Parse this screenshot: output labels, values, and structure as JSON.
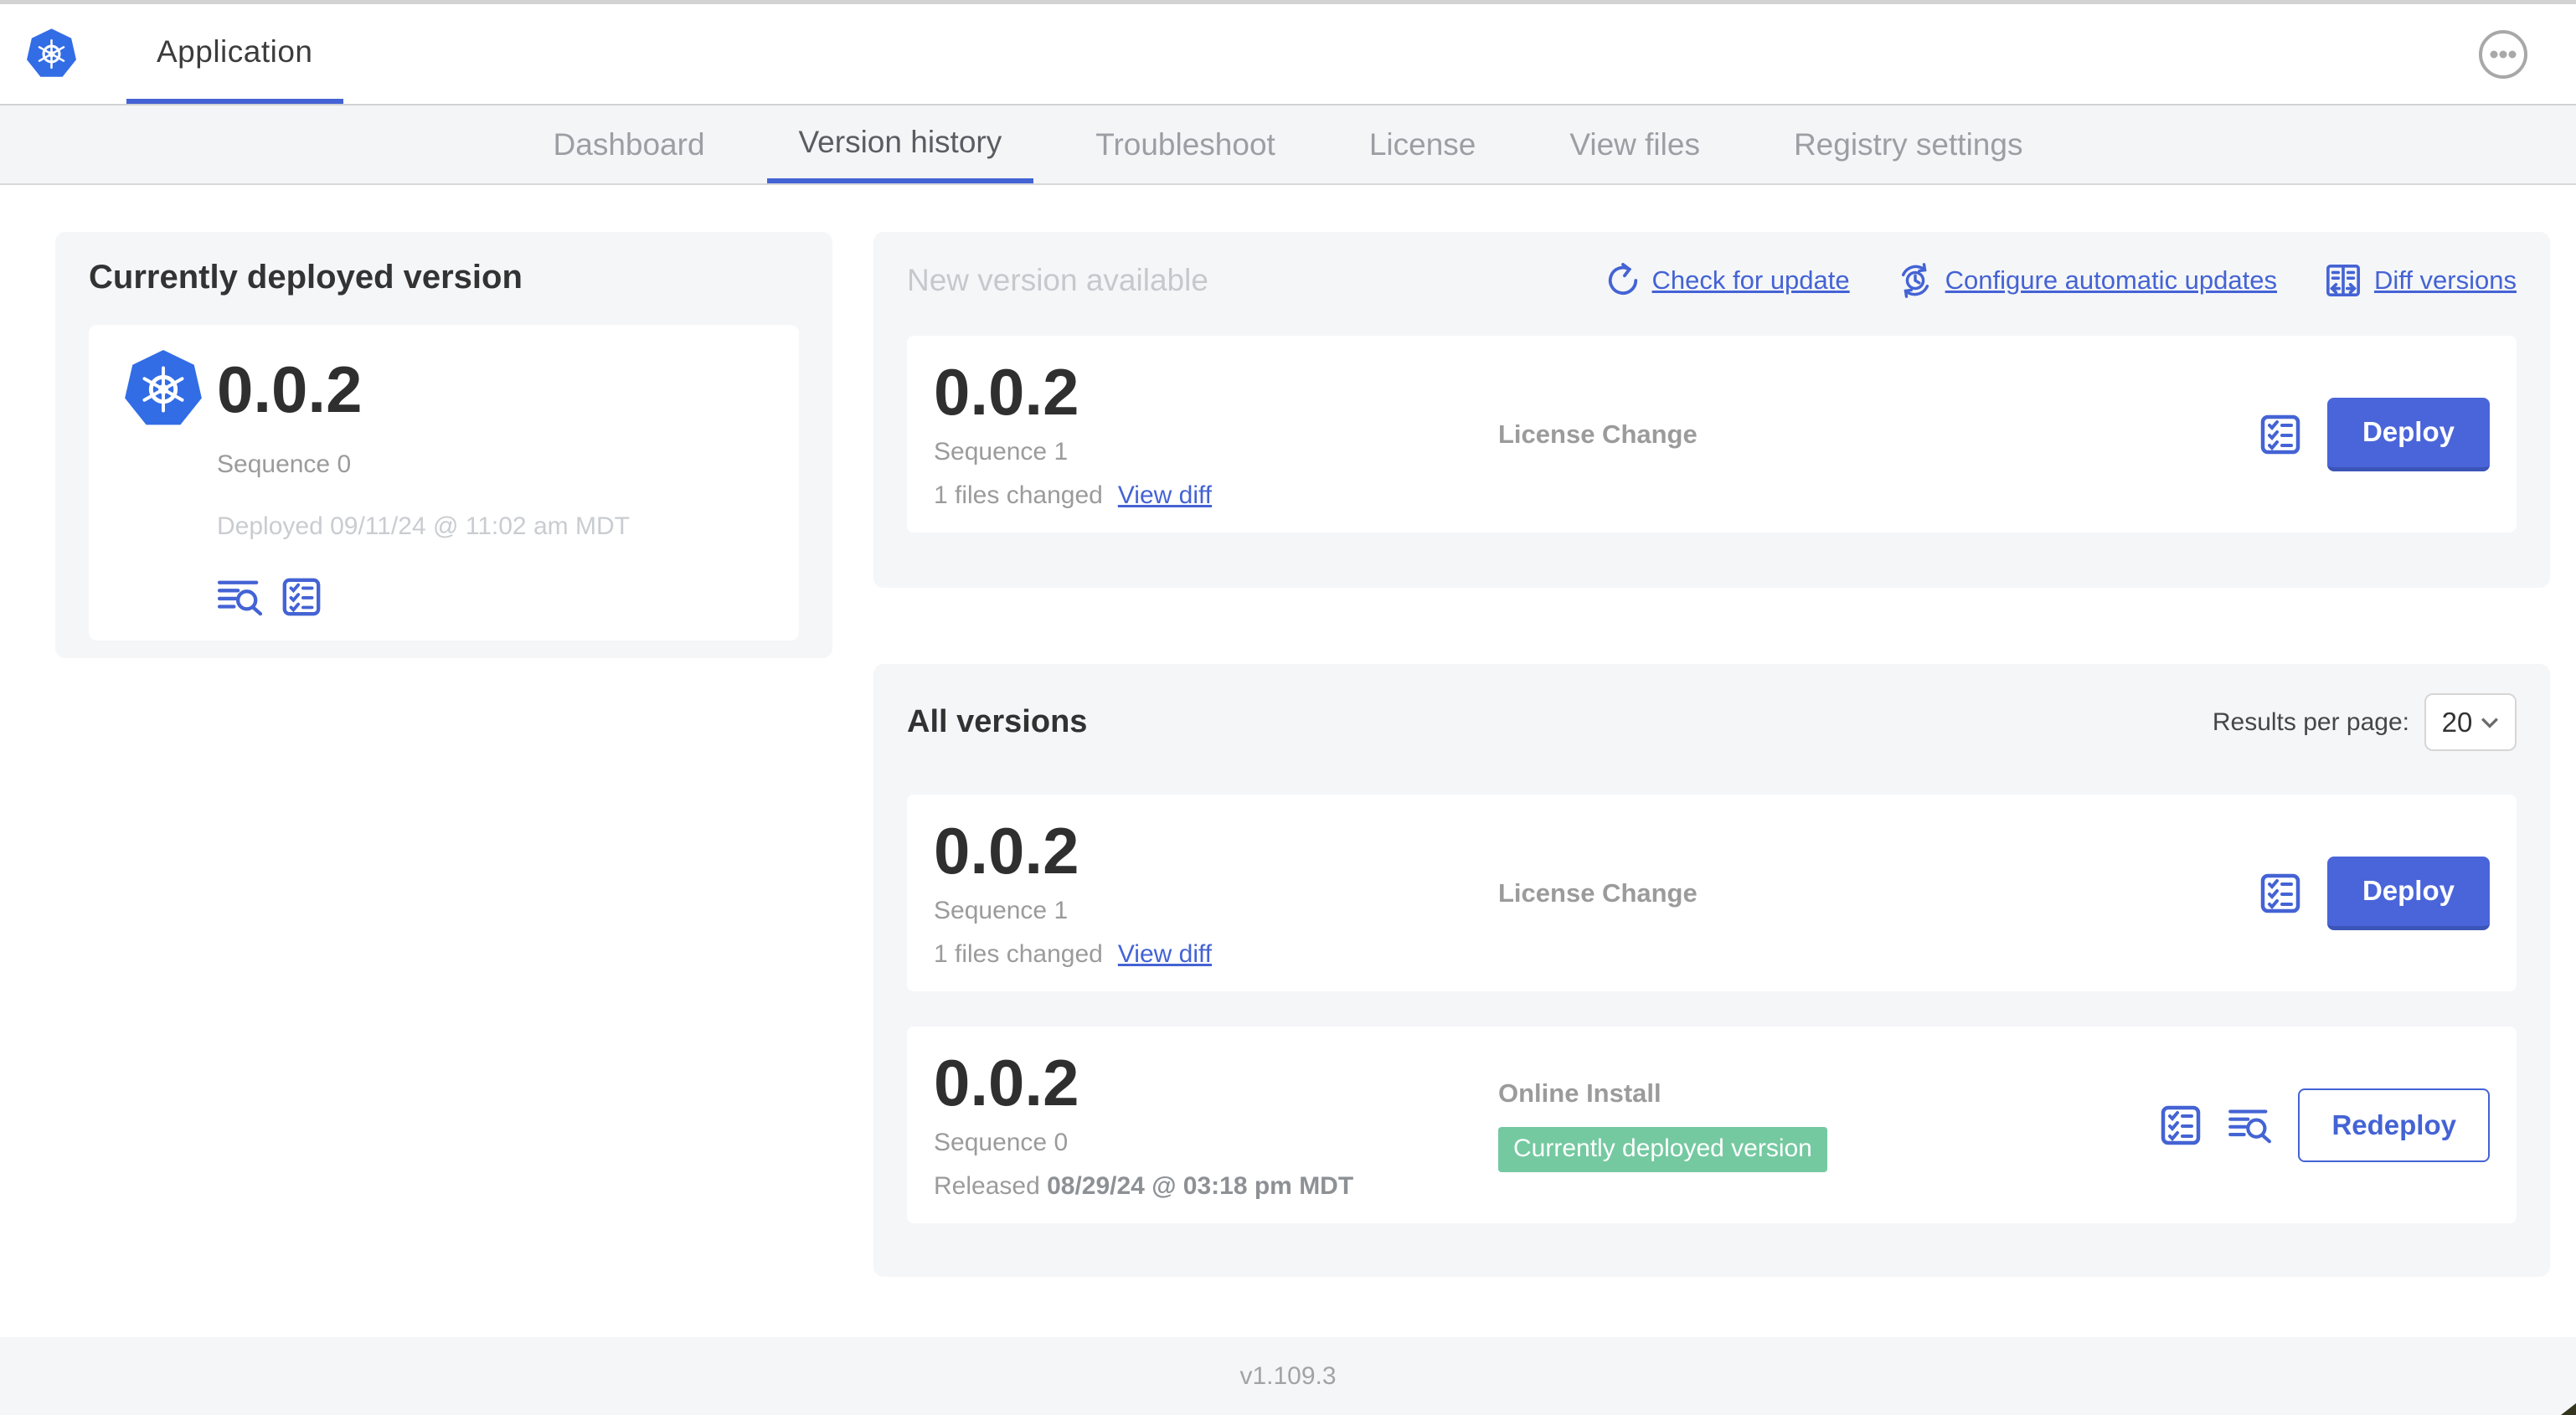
{
  "header": {
    "app_title": "Application"
  },
  "nav": {
    "tabs": [
      {
        "label": "Dashboard",
        "active": false
      },
      {
        "label": "Version history",
        "active": true
      },
      {
        "label": "Troubleshoot",
        "active": false
      },
      {
        "label": "License",
        "active": false
      },
      {
        "label": "View files",
        "active": false
      },
      {
        "label": "Registry settings",
        "active": false
      }
    ]
  },
  "currently_deployed": {
    "title": "Currently deployed version",
    "version": "0.0.2",
    "sequence": "Sequence 0",
    "deployed": "Deployed 09/11/24 @ 11:02 am MDT"
  },
  "new_version": {
    "title": "New version available",
    "links": [
      {
        "label": "Check for update",
        "icon": "refresh-icon"
      },
      {
        "label": "Configure automatic updates",
        "icon": "auto-update-clock-icon"
      },
      {
        "label": "Diff versions",
        "icon": "diff-icon"
      }
    ],
    "card": {
      "version": "0.0.2",
      "sequence": "Sequence 1",
      "files_changed": "1 files changed",
      "view_diff_label": "View diff",
      "source": "License Change",
      "action_label": "Deploy"
    }
  },
  "all_versions": {
    "title": "All versions",
    "results_per_page_label": "Results per page:",
    "results_per_page_value": "20",
    "rows": [
      {
        "version": "0.0.2",
        "sequence": "Sequence 1",
        "files_changed": "1 files changed",
        "view_diff_label": "View diff",
        "source": "License Change",
        "action_label": "Deploy"
      },
      {
        "version": "0.0.2",
        "sequence": "Sequence 0",
        "released_prefix": "Released ",
        "released_date": "08/29/24 @ 03:18 pm MDT",
        "source": "Online Install",
        "badge": "Currently deployed version",
        "action_label": "Redeploy"
      }
    ]
  },
  "footer": {
    "app_version": "v1.109.3"
  },
  "colors": {
    "accent_blue": "#4463d4",
    "kubernetes_blue": "#326de6",
    "badge_green": "#74c9a1",
    "panel_gray": "#f5f6f8"
  }
}
